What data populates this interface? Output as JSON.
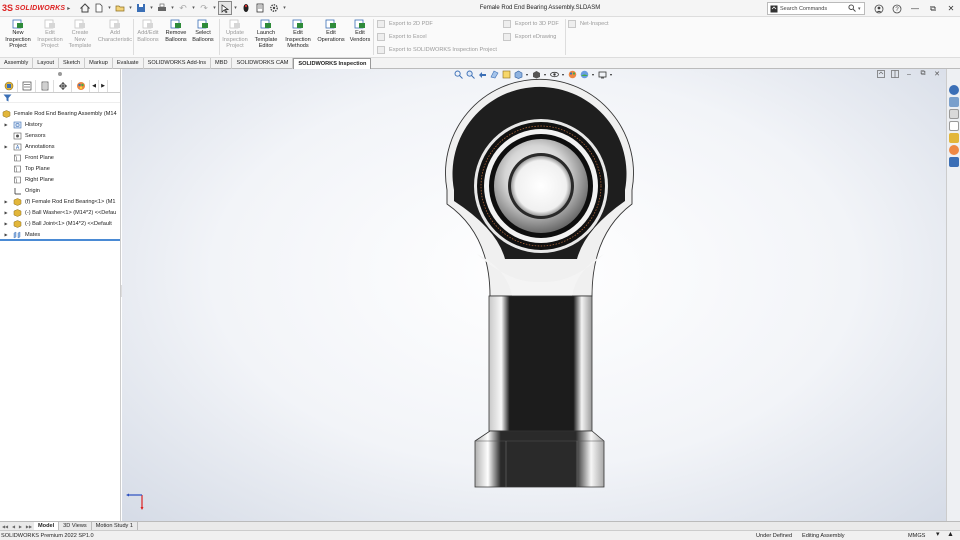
{
  "app": {
    "brand_ds": "3S",
    "brand_name": "SOLIDWORKS",
    "document_title": "Female Rod End Bearing Assembly.SLDASM"
  },
  "search": {
    "placeholder": "Search Commands"
  },
  "ribbon": {
    "buttons": [
      {
        "label_lines": [
          "New",
          "Inspection",
          "Project"
        ],
        "enabled": true,
        "icon": "new-inspection-project-icon"
      },
      {
        "label_lines": [
          "Edit",
          "Inspection",
          "Project"
        ],
        "enabled": false,
        "icon": "edit-inspection-project-icon"
      },
      {
        "label_lines": [
          "Create",
          "New",
          "Template"
        ],
        "enabled": false,
        "icon": "create-template-icon"
      },
      {
        "label_lines": [
          "Add",
          "Characteristic"
        ],
        "enabled": false,
        "icon": "add-characteristic-icon"
      },
      {
        "label_lines": [
          "Add/Edit",
          "Balloons"
        ],
        "enabled": false,
        "icon": "add-edit-balloons-icon"
      },
      {
        "label_lines": [
          "Remove",
          "Balloons"
        ],
        "enabled": true,
        "icon": "remove-balloons-icon"
      },
      {
        "label_lines": [
          "Select",
          "Balloons"
        ],
        "enabled": true,
        "icon": "select-balloons-icon"
      },
      {
        "label_lines": [
          "Update",
          "Inspection",
          "Project"
        ],
        "enabled": false,
        "icon": "update-inspection-project-icon"
      },
      {
        "label_lines": [
          "Launch",
          "Template",
          "Editor"
        ],
        "enabled": true,
        "icon": "launch-template-editor-icon"
      },
      {
        "label_lines": [
          "Edit",
          "Inspection",
          "Methods"
        ],
        "enabled": true,
        "icon": "edit-inspection-methods-icon"
      },
      {
        "label_lines": [
          "Edit",
          "Operations"
        ],
        "enabled": true,
        "icon": "edit-operations-icon"
      },
      {
        "label_lines": [
          "Edit",
          "Vendors"
        ],
        "enabled": true,
        "icon": "edit-vendors-icon"
      }
    ],
    "export_2d_pdf": "Export to 2D PDF",
    "export_excel": "Export to Excel",
    "export_inspection_project": "Export to SOLIDWORKS Inspection Project",
    "export_3d_pdf": "Export to 3D PDF",
    "export_edrawing": "Export eDrawing",
    "net_inspect": "Net-Inspect"
  },
  "tabs": [
    "Assembly",
    "Layout",
    "Sketch",
    "Markup",
    "Evaluate",
    "SOLIDWORKS Add-Ins",
    "MBD",
    "SOLIDWORKS CAM",
    "SOLIDWORKS Inspection"
  ],
  "active_tab": "SOLIDWORKS Inspection",
  "feature_tree": {
    "root": "Female Rod End Bearing Assembly (M14",
    "items": [
      {
        "label": "History",
        "expandable": true,
        "icon": "history-icon"
      },
      {
        "label": "Sensors",
        "expandable": false,
        "icon": "sensors-icon"
      },
      {
        "label": "Annotations",
        "expandable": true,
        "icon": "annotations-icon"
      },
      {
        "label": "Front Plane",
        "expandable": false,
        "icon": "plane-icon"
      },
      {
        "label": "Top Plane",
        "expandable": false,
        "icon": "plane-icon"
      },
      {
        "label": "Right Plane",
        "expandable": false,
        "icon": "plane-icon"
      },
      {
        "label": "Origin",
        "expandable": false,
        "icon": "origin-icon"
      },
      {
        "label": "(f) Female Rod End Bearing<1> (M1",
        "expandable": true,
        "icon": "part-icon"
      },
      {
        "label": "(-) Ball Washer<1> (M14*2) <<Defau",
        "expandable": true,
        "icon": "part-icon"
      },
      {
        "label": "(-) Ball Joint<1> (M14*2) <<Default",
        "expandable": true,
        "icon": "part-icon"
      },
      {
        "label": "Mates",
        "expandable": true,
        "icon": "mates-icon"
      }
    ]
  },
  "bottom_tabs": [
    "Model",
    "3D Views",
    "Motion Study 1"
  ],
  "active_bottom_tab": "Model",
  "status": {
    "product": "SOLIDWORKS Premium 2022 SP1.0",
    "state": "Under Defined",
    "mode": "Editing Assembly",
    "units": "MMGS"
  },
  "colors": {
    "brand_red": "#d22222",
    "highlight_blue": "#4a8ad4",
    "part_dark": "#1e1e1e",
    "part_light": "#f0f0f0"
  }
}
